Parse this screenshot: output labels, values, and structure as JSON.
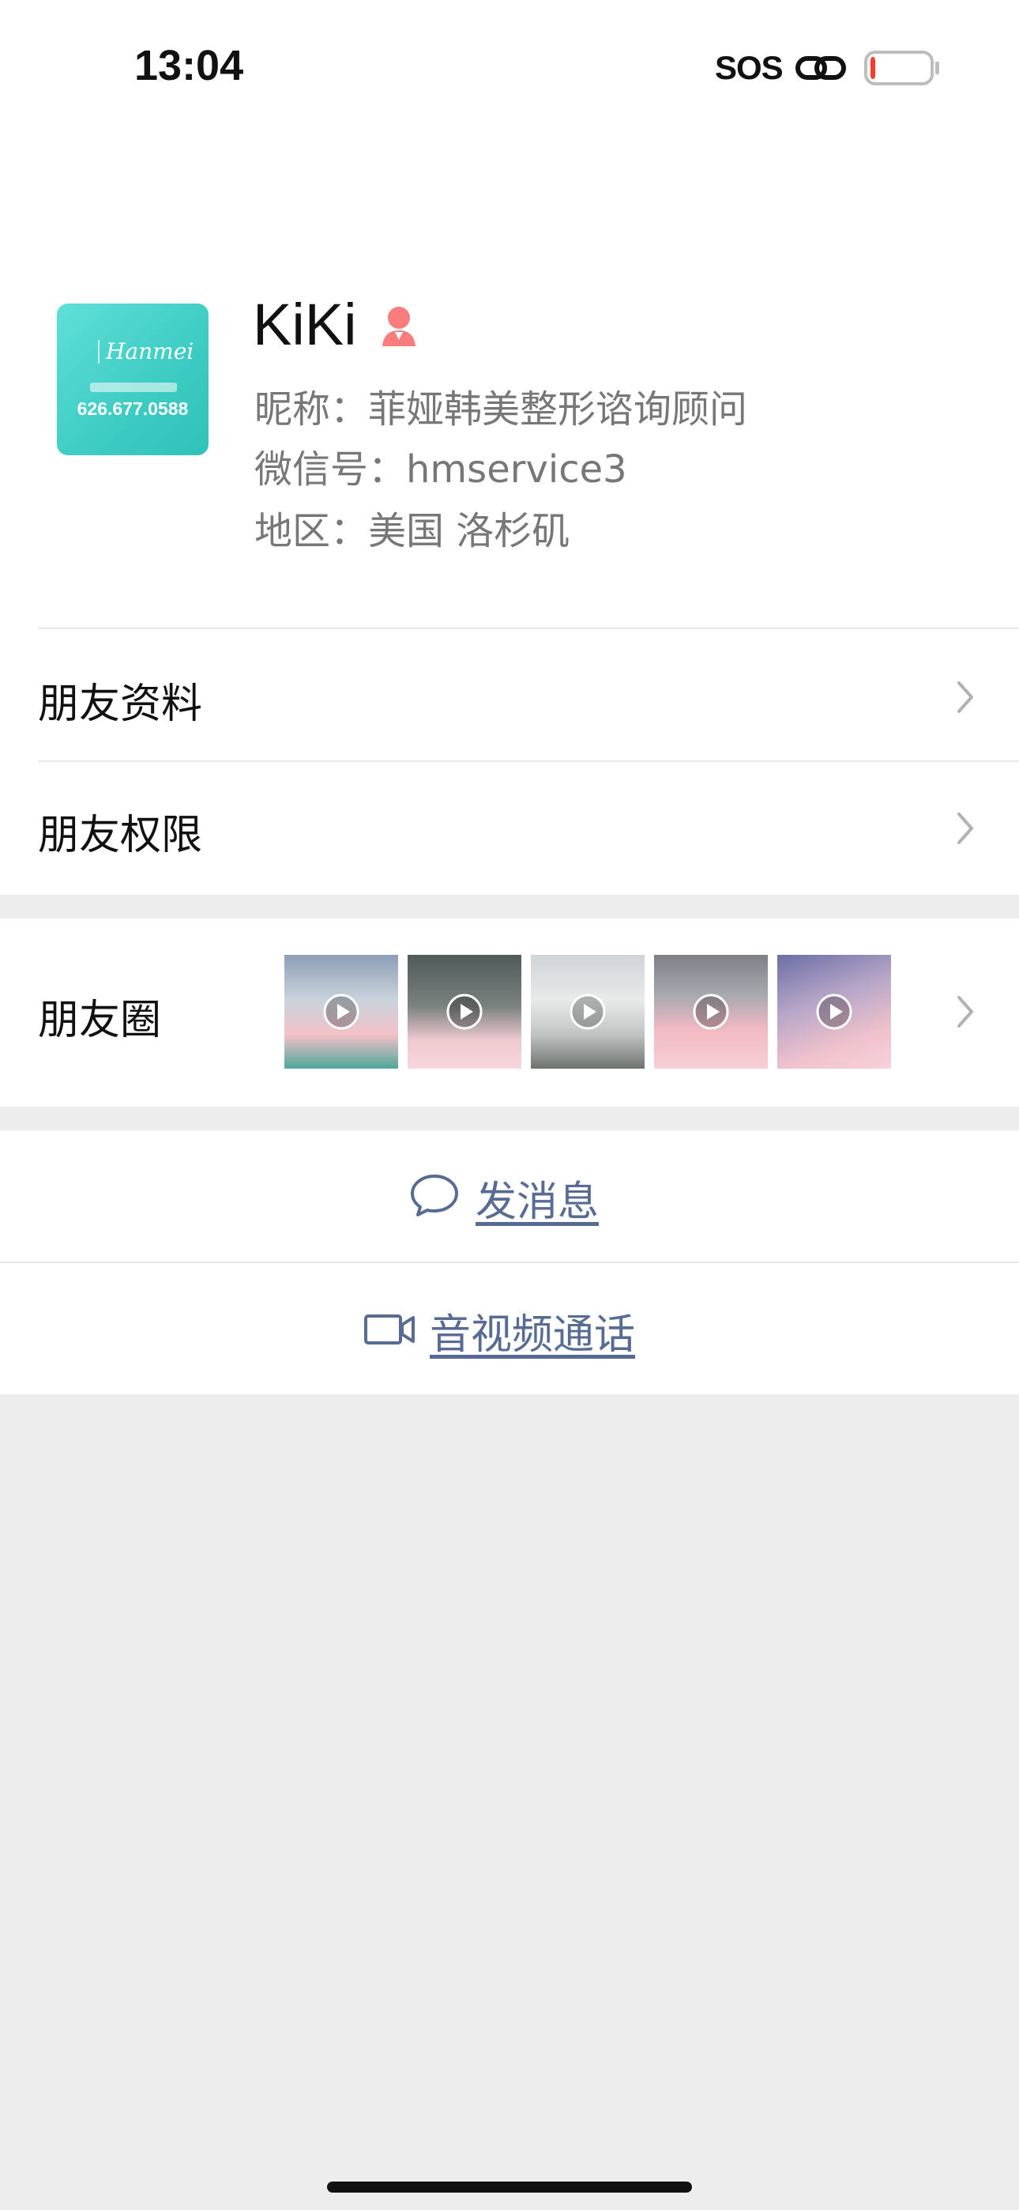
{
  "status_bar": {
    "time": "13:04",
    "sos": "SOS",
    "icons": [
      "link-icon",
      "battery-low-icon"
    ],
    "battery_level": 0.08,
    "battery_color": "#ff3b30"
  },
  "nav": {
    "back_icon": "chevron-left-icon",
    "more_icon": "ellipsis-icon"
  },
  "profile": {
    "avatar_brand": "Hanmei",
    "avatar_phone": "626.677.0588",
    "name": "KiKi",
    "gender_icon": "female-icon",
    "gender_color": "#fa7c7c",
    "nickname": "昵称：菲娅韩美整形谘询顾问",
    "wechat_id": "微信号：hmservice3",
    "region": "地区：美国 洛杉矶"
  },
  "rows": {
    "friend_profile": "朋友资料",
    "friend_permissions": "朋友权限",
    "moments": "朋友圈"
  },
  "moments_thumbs": {
    "count": 5,
    "type": "video",
    "icon": "play-icon"
  },
  "actions": {
    "send_message": "发消息",
    "send_message_icon": "chat-bubble-icon",
    "voice_video_call": "音视频通话",
    "voice_video_call_icon": "video-camera-icon",
    "link_color": "#576b95"
  }
}
